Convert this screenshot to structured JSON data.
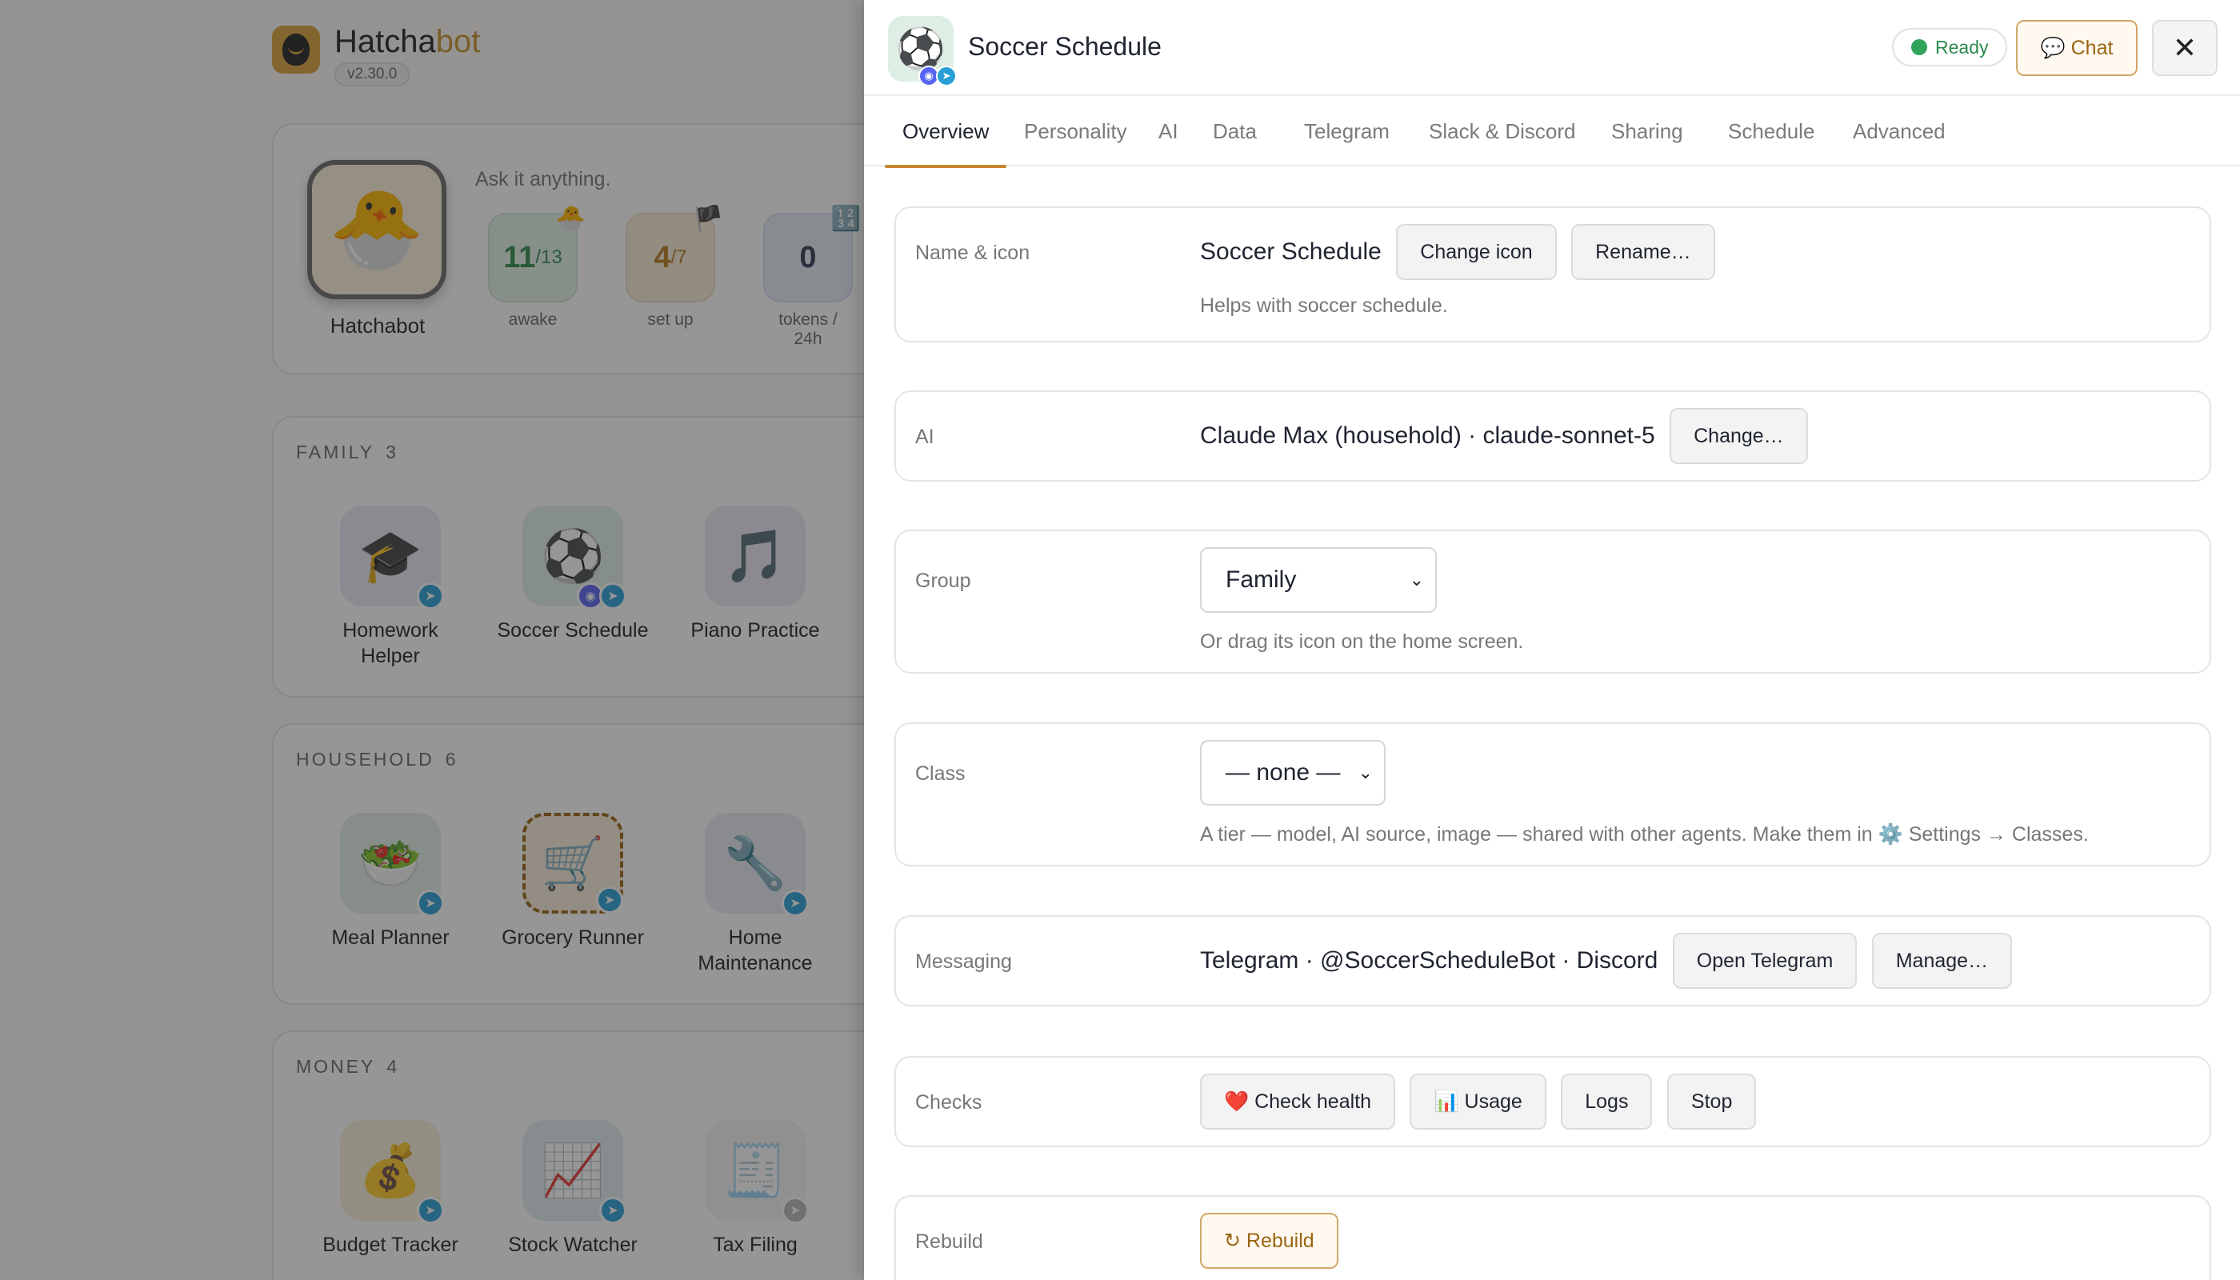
{
  "home": {
    "brand_name_a": "Hatcha",
    "brand_name_b": "bot",
    "version": "v2.30.0",
    "hero": {
      "name": "Hatchabot",
      "tagline": "Ask it anything.",
      "stats": [
        {
          "value": "11",
          "suffix": "/13",
          "label": "awake",
          "badge": "🐣"
        },
        {
          "value": "4",
          "suffix": "/7",
          "label": "set up",
          "badge": "🏴"
        },
        {
          "value": "0",
          "suffix": "",
          "label": "tokens / 24h",
          "badge": "🔢"
        }
      ]
    },
    "sections": [
      {
        "title": "FAMILY",
        "count": "3",
        "apps": [
          {
            "name": "Homework Helper",
            "icon": "🎓"
          },
          {
            "name": "Soccer Schedule",
            "icon": "⚽"
          },
          {
            "name": "Piano Practice",
            "icon": "🎵"
          }
        ]
      },
      {
        "title": "HOUSEHOLD",
        "count": "6",
        "apps": [
          {
            "name": "Meal Planner",
            "icon": "🥗"
          },
          {
            "name": "Grocery Runner",
            "icon": "🛒"
          },
          {
            "name": "Home Maintenance",
            "icon": "🔧"
          }
        ]
      },
      {
        "title": "MONEY",
        "count": "4",
        "apps": [
          {
            "name": "Budget Tracker",
            "icon": "💰"
          },
          {
            "name": "Stock Watcher",
            "icon": "📈"
          },
          {
            "name": "Tax Filing",
            "icon": "🧾"
          }
        ]
      }
    ]
  },
  "drawer": {
    "title": "Soccer Schedule",
    "icon": "⚽",
    "status": "Ready",
    "chat_label": "💬 Chat",
    "close_label": "✕",
    "tabs": [
      "Overview",
      "Personality",
      "AI",
      "Data",
      "Telegram",
      "Slack & Discord",
      "Sharing",
      "Schedule",
      "Advanced"
    ],
    "rows": {
      "name": {
        "label": "Name & icon",
        "value": "Soccer Schedule",
        "btn1": "Change icon",
        "btn2": "Rename…",
        "hint": "Helps with soccer schedule."
      },
      "ai": {
        "label": "AI",
        "value": "Claude Max (household) · claude-sonnet-5",
        "btn": "Change…"
      },
      "group": {
        "label": "Group",
        "value": "Family",
        "hint": "Or drag its icon on the home screen."
      },
      "class": {
        "label": "Class",
        "value": "— none —",
        "hint": "A tier — model, AI source, image — shared with other agents. Make them in ⚙️ Settings → Classes."
      },
      "messaging": {
        "label": "Messaging",
        "value": "Telegram · @SoccerScheduleBot · Discord",
        "btn1": "Open Telegram",
        "btn2": "Manage…"
      },
      "checks": {
        "label": "Checks",
        "btn1": "❤️ Check health",
        "btn2": "📊 Usage",
        "btn3": "Logs",
        "btn4": "Stop"
      },
      "rebuild": {
        "label": "Rebuild",
        "btn": "↻ Rebuild"
      }
    }
  }
}
